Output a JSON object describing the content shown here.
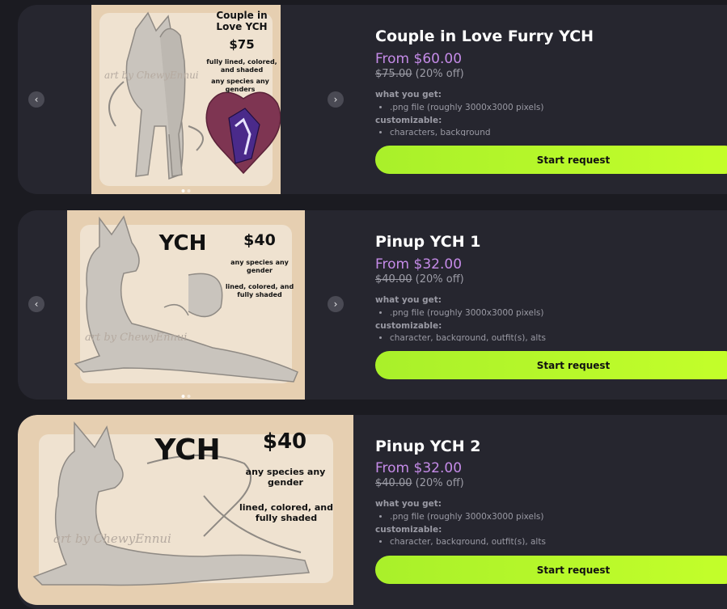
{
  "nav": {
    "prev_glyph": "‹",
    "next_glyph": "›"
  },
  "products": [
    {
      "title": "Couple in Love Furry YCH",
      "price": "From $60.00",
      "old_price": "$75.00",
      "discount": "(20% off)",
      "what_label": "what you get:",
      "what_items": [
        ".png file (roughly 3000x3000 pixels)"
      ],
      "custom_label": "customizable:",
      "custom_items": [
        "characters, background"
      ],
      "button": "Start request",
      "art": {
        "heading": "Couple in Love YCH",
        "price": "$75",
        "line1": "fully lined, colored, and shaded",
        "line2": "any species any genders",
        "watermark": "art by ChewyEnnui"
      }
    },
    {
      "title": "Pinup YCH 1",
      "price": "From $32.00",
      "old_price": "$40.00",
      "discount": "(20% off)",
      "what_label": "what you get:",
      "what_items": [
        ".png file (roughly 3000x3000 pixels)"
      ],
      "custom_label": "customizable:",
      "custom_items": [
        "character, background, outfit(s), alts"
      ],
      "button": "Start request",
      "art": {
        "heading": "YCH",
        "price": "$40",
        "line1": "any species any gender",
        "line2": "lined, colored, and fully shaded",
        "watermark": "art by ChewyEnnui"
      }
    },
    {
      "title": "Pinup YCH 2",
      "price": "From $32.00",
      "old_price": "$40.00",
      "discount": "(20% off)",
      "what_label": "what you get:",
      "what_items": [
        ".png file (roughly 3000x3000 pixels)"
      ],
      "custom_label": "customizable:",
      "custom_items": [
        "character, background, outfit(s), alts"
      ],
      "button": "Start request",
      "art": {
        "heading": "YCH",
        "price": "$40",
        "line1": "any species any gender",
        "line2": "lined, colored, and fully shaded",
        "watermark": "art by ChewyEnnui"
      }
    }
  ],
  "colors": {
    "background": "#1b1b21",
    "card": "#26262f",
    "price": "#c58be8",
    "button": "#b6f52a"
  }
}
